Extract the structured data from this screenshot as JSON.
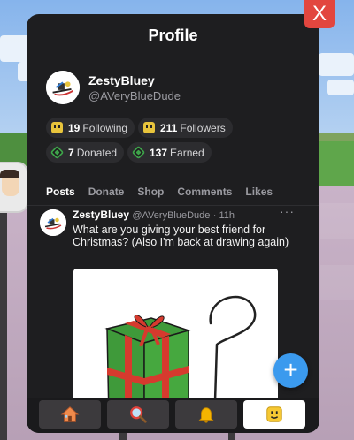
{
  "close_label": "X",
  "profile": {
    "title": "Profile",
    "display_name": "ZestyBluey",
    "handle": "@AVeryBlueDude",
    "stats": {
      "following_count": "19",
      "following_label": "Following",
      "followers_count": "211",
      "followers_label": "Followers",
      "donated_count": "7",
      "donated_label": "Donated",
      "earned_count": "137",
      "earned_label": "Earned"
    }
  },
  "tabs": [
    "Posts",
    "Donate",
    "Shop",
    "Comments",
    "Likes"
  ],
  "active_tab": "Posts",
  "post": {
    "author": "ZestyBluey",
    "handle": "@AVeryBlueDude",
    "time": "· 11h",
    "more_label": "···",
    "text": "What are you giving your best friend for Christmas? (Also I'm back at drawing again)"
  },
  "fab_label": "+",
  "bottom_nav": [
    {
      "name": "home",
      "icon": "home-icon"
    },
    {
      "name": "search",
      "icon": "search-icon"
    },
    {
      "name": "notifications",
      "icon": "bell-icon"
    },
    {
      "name": "profile",
      "icon": "smiley-face-icon"
    }
  ],
  "colors": {
    "panel": "#1e1e20",
    "close": "#e2463f",
    "fab": "#3b9aee",
    "robux_green": "#3ea34a",
    "gift_green": "#3f9a3a",
    "ribbon_red": "#d63a2e"
  }
}
